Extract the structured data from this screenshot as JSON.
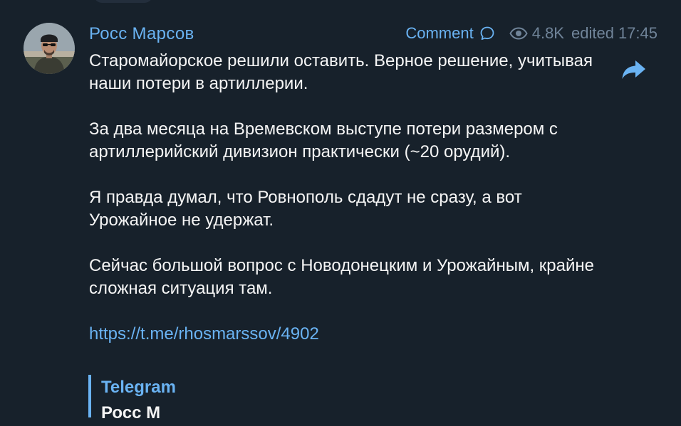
{
  "post": {
    "author": "Росс Марсов",
    "comment_label": "Comment",
    "views": "4.8K",
    "edited_label": "edited",
    "time": "17:45",
    "paragraphs": [
      "Старомайорское решили оставить. Верное решение, учитывая наши потери в артиллерии.",
      "За два месяца на Времевском выступе потери размером с артиллерийский дивизион практически (~20 орудий).",
      "Я правда думал, что Ровнополь сдадут не сразу, а вот Урожайное не удержат.",
      "Сейчас большой вопрос с Новодонецким и Урожайным, крайне сложная ситуация там."
    ],
    "link": "https://t.me/rhosmarssov/4902",
    "preview": {
      "site": "Telegram",
      "title": "Росс М"
    }
  },
  "icons": {
    "comment": "comment-bubble-icon",
    "views": "eye-icon",
    "share": "share-arrow-icon"
  },
  "colors": {
    "background": "#17212b",
    "accent": "#6ab3f3",
    "text": "#f5f5f5",
    "meta": "#708499"
  }
}
